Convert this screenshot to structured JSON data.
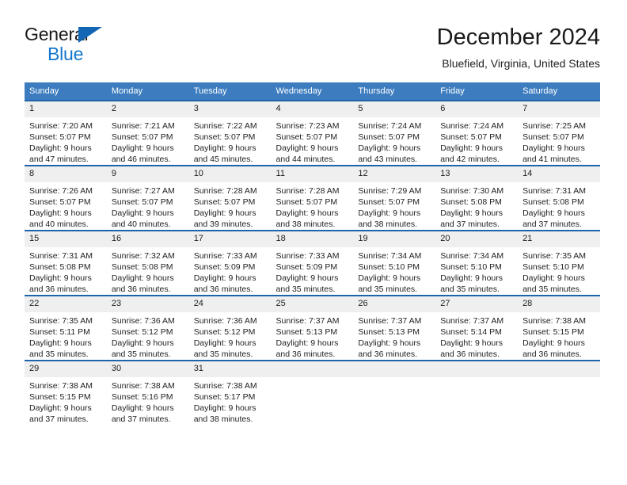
{
  "brand": {
    "name_top": "General",
    "name_bottom": "Blue",
    "triangle_color": "#1266b3",
    "bottom_color": "#1277cc"
  },
  "header": {
    "title": "December 2024",
    "subtitle": "Bluefield, Virginia, United States"
  },
  "theme": {
    "header_bg": "#3d7dbf",
    "row_border": "#1f63ab",
    "daynum_bg": "#efefef",
    "text": "#222222"
  },
  "weekdays": [
    "Sunday",
    "Monday",
    "Tuesday",
    "Wednesday",
    "Thursday",
    "Friday",
    "Saturday"
  ],
  "weeks": [
    [
      {
        "day": "1",
        "sunrise": "Sunrise: 7:20 AM",
        "sunset": "Sunset: 5:07 PM",
        "daylight1": "Daylight: 9 hours",
        "daylight2": "and 47 minutes."
      },
      {
        "day": "2",
        "sunrise": "Sunrise: 7:21 AM",
        "sunset": "Sunset: 5:07 PM",
        "daylight1": "Daylight: 9 hours",
        "daylight2": "and 46 minutes."
      },
      {
        "day": "3",
        "sunrise": "Sunrise: 7:22 AM",
        "sunset": "Sunset: 5:07 PM",
        "daylight1": "Daylight: 9 hours",
        "daylight2": "and 45 minutes."
      },
      {
        "day": "4",
        "sunrise": "Sunrise: 7:23 AM",
        "sunset": "Sunset: 5:07 PM",
        "daylight1": "Daylight: 9 hours",
        "daylight2": "and 44 minutes."
      },
      {
        "day": "5",
        "sunrise": "Sunrise: 7:24 AM",
        "sunset": "Sunset: 5:07 PM",
        "daylight1": "Daylight: 9 hours",
        "daylight2": "and 43 minutes."
      },
      {
        "day": "6",
        "sunrise": "Sunrise: 7:24 AM",
        "sunset": "Sunset: 5:07 PM",
        "daylight1": "Daylight: 9 hours",
        "daylight2": "and 42 minutes."
      },
      {
        "day": "7",
        "sunrise": "Sunrise: 7:25 AM",
        "sunset": "Sunset: 5:07 PM",
        "daylight1": "Daylight: 9 hours",
        "daylight2": "and 41 minutes."
      }
    ],
    [
      {
        "day": "8",
        "sunrise": "Sunrise: 7:26 AM",
        "sunset": "Sunset: 5:07 PM",
        "daylight1": "Daylight: 9 hours",
        "daylight2": "and 40 minutes."
      },
      {
        "day": "9",
        "sunrise": "Sunrise: 7:27 AM",
        "sunset": "Sunset: 5:07 PM",
        "daylight1": "Daylight: 9 hours",
        "daylight2": "and 40 minutes."
      },
      {
        "day": "10",
        "sunrise": "Sunrise: 7:28 AM",
        "sunset": "Sunset: 5:07 PM",
        "daylight1": "Daylight: 9 hours",
        "daylight2": "and 39 minutes."
      },
      {
        "day": "11",
        "sunrise": "Sunrise: 7:28 AM",
        "sunset": "Sunset: 5:07 PM",
        "daylight1": "Daylight: 9 hours",
        "daylight2": "and 38 minutes."
      },
      {
        "day": "12",
        "sunrise": "Sunrise: 7:29 AM",
        "sunset": "Sunset: 5:07 PM",
        "daylight1": "Daylight: 9 hours",
        "daylight2": "and 38 minutes."
      },
      {
        "day": "13",
        "sunrise": "Sunrise: 7:30 AM",
        "sunset": "Sunset: 5:08 PM",
        "daylight1": "Daylight: 9 hours",
        "daylight2": "and 37 minutes."
      },
      {
        "day": "14",
        "sunrise": "Sunrise: 7:31 AM",
        "sunset": "Sunset: 5:08 PM",
        "daylight1": "Daylight: 9 hours",
        "daylight2": "and 37 minutes."
      }
    ],
    [
      {
        "day": "15",
        "sunrise": "Sunrise: 7:31 AM",
        "sunset": "Sunset: 5:08 PM",
        "daylight1": "Daylight: 9 hours",
        "daylight2": "and 36 minutes."
      },
      {
        "day": "16",
        "sunrise": "Sunrise: 7:32 AM",
        "sunset": "Sunset: 5:08 PM",
        "daylight1": "Daylight: 9 hours",
        "daylight2": "and 36 minutes."
      },
      {
        "day": "17",
        "sunrise": "Sunrise: 7:33 AM",
        "sunset": "Sunset: 5:09 PM",
        "daylight1": "Daylight: 9 hours",
        "daylight2": "and 36 minutes."
      },
      {
        "day": "18",
        "sunrise": "Sunrise: 7:33 AM",
        "sunset": "Sunset: 5:09 PM",
        "daylight1": "Daylight: 9 hours",
        "daylight2": "and 35 minutes."
      },
      {
        "day": "19",
        "sunrise": "Sunrise: 7:34 AM",
        "sunset": "Sunset: 5:10 PM",
        "daylight1": "Daylight: 9 hours",
        "daylight2": "and 35 minutes."
      },
      {
        "day": "20",
        "sunrise": "Sunrise: 7:34 AM",
        "sunset": "Sunset: 5:10 PM",
        "daylight1": "Daylight: 9 hours",
        "daylight2": "and 35 minutes."
      },
      {
        "day": "21",
        "sunrise": "Sunrise: 7:35 AM",
        "sunset": "Sunset: 5:10 PM",
        "daylight1": "Daylight: 9 hours",
        "daylight2": "and 35 minutes."
      }
    ],
    [
      {
        "day": "22",
        "sunrise": "Sunrise: 7:35 AM",
        "sunset": "Sunset: 5:11 PM",
        "daylight1": "Daylight: 9 hours",
        "daylight2": "and 35 minutes."
      },
      {
        "day": "23",
        "sunrise": "Sunrise: 7:36 AM",
        "sunset": "Sunset: 5:12 PM",
        "daylight1": "Daylight: 9 hours",
        "daylight2": "and 35 minutes."
      },
      {
        "day": "24",
        "sunrise": "Sunrise: 7:36 AM",
        "sunset": "Sunset: 5:12 PM",
        "daylight1": "Daylight: 9 hours",
        "daylight2": "and 35 minutes."
      },
      {
        "day": "25",
        "sunrise": "Sunrise: 7:37 AM",
        "sunset": "Sunset: 5:13 PM",
        "daylight1": "Daylight: 9 hours",
        "daylight2": "and 36 minutes."
      },
      {
        "day": "26",
        "sunrise": "Sunrise: 7:37 AM",
        "sunset": "Sunset: 5:13 PM",
        "daylight1": "Daylight: 9 hours",
        "daylight2": "and 36 minutes."
      },
      {
        "day": "27",
        "sunrise": "Sunrise: 7:37 AM",
        "sunset": "Sunset: 5:14 PM",
        "daylight1": "Daylight: 9 hours",
        "daylight2": "and 36 minutes."
      },
      {
        "day": "28",
        "sunrise": "Sunrise: 7:38 AM",
        "sunset": "Sunset: 5:15 PM",
        "daylight1": "Daylight: 9 hours",
        "daylight2": "and 36 minutes."
      }
    ],
    [
      {
        "day": "29",
        "sunrise": "Sunrise: 7:38 AM",
        "sunset": "Sunset: 5:15 PM",
        "daylight1": "Daylight: 9 hours",
        "daylight2": "and 37 minutes."
      },
      {
        "day": "30",
        "sunrise": "Sunrise: 7:38 AM",
        "sunset": "Sunset: 5:16 PM",
        "daylight1": "Daylight: 9 hours",
        "daylight2": "and 37 minutes."
      },
      {
        "day": "31",
        "sunrise": "Sunrise: 7:38 AM",
        "sunset": "Sunset: 5:17 PM",
        "daylight1": "Daylight: 9 hours",
        "daylight2": "and 38 minutes."
      },
      {
        "day": "",
        "sunrise": "",
        "sunset": "",
        "daylight1": "",
        "daylight2": ""
      },
      {
        "day": "",
        "sunrise": "",
        "sunset": "",
        "daylight1": "",
        "daylight2": ""
      },
      {
        "day": "",
        "sunrise": "",
        "sunset": "",
        "daylight1": "",
        "daylight2": ""
      },
      {
        "day": "",
        "sunrise": "",
        "sunset": "",
        "daylight1": "",
        "daylight2": ""
      }
    ]
  ]
}
